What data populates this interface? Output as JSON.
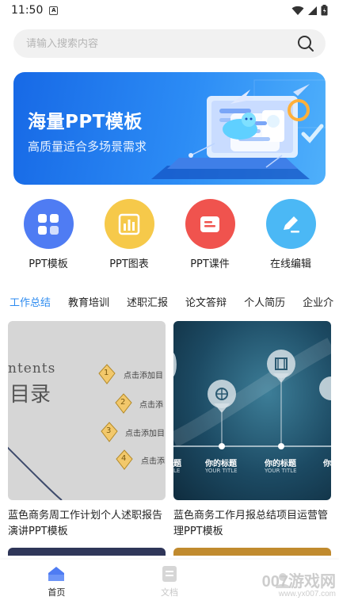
{
  "status": {
    "time": "11:50",
    "app_icon": "A"
  },
  "search": {
    "placeholder": "请输入搜索内容"
  },
  "banner": {
    "title": "海量PPT模板",
    "subtitle": "高质量适合多场景需求"
  },
  "quick_actions": [
    {
      "label": "PPT模板",
      "color": "#4f7cf3",
      "icon": "grid-icon"
    },
    {
      "label": "PPT图表",
      "color": "#f6c94a",
      "icon": "bar-chart-icon"
    },
    {
      "label": "PPT课件",
      "color": "#f0534e",
      "icon": "courseware-icon"
    },
    {
      "label": "在线编辑",
      "color": "#4bb8f5",
      "icon": "edit-icon"
    }
  ],
  "tabs": [
    "工作总结",
    "教育培训",
    "述职汇报",
    "论文答辩",
    "个人简历",
    "企业介"
  ],
  "cards": [
    {
      "title": "蓝色商务周工作计划个人述职报告演讲PPT模板",
      "thumb": {
        "heading_en": "ntents",
        "heading_cn": "目录",
        "items": [
          "点击添加目",
          "点击添",
          "点击添加目",
          "点击添"
        ],
        "nums": [
          "1",
          "2",
          "3",
          "4"
        ]
      }
    },
    {
      "title": "蓝色商务工作月报总结项目运营管理PPT模板",
      "thumb": {
        "labels": [
          "题",
          "你的标题",
          "你的标题",
          "你"
        ],
        "sublabels": [
          "LE",
          "YOUR TITLE",
          "YOUR TITLE",
          ""
        ]
      }
    }
  ],
  "nav": {
    "home": "首页",
    "docs": "文档"
  },
  "watermark": {
    "main": "007游戏网",
    "url": "www.yx007.com"
  }
}
